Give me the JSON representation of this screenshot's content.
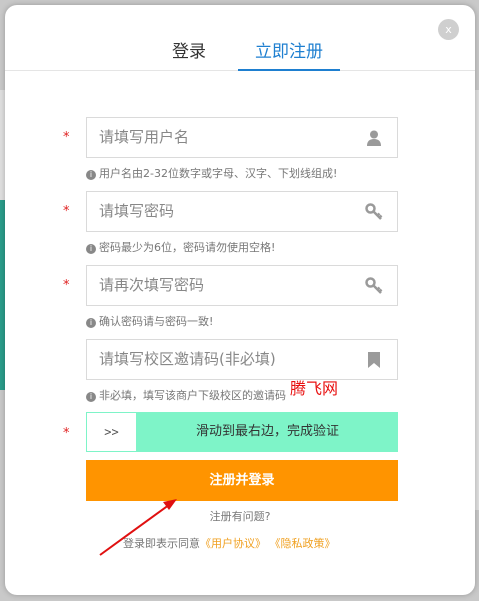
{
  "dialog": {
    "close_label": "x",
    "tabs": [
      {
        "label": "登录",
        "active": false
      },
      {
        "label": "立即注册",
        "active": true
      }
    ]
  },
  "form": {
    "username": {
      "placeholder": "请填写用户名",
      "hint": "用户名由2-32位数字或字母、汉字、下划线组成!",
      "required": "*",
      "icon": "user-icon"
    },
    "password": {
      "placeholder": "请填写密码",
      "hint": "密码最少为6位，密码请勿使用空格!",
      "required": "*",
      "icon": "key-icon"
    },
    "confirm": {
      "placeholder": "请再次填写密码",
      "hint": "确认密码请与密码一致!",
      "required": "*",
      "icon": "key-icon"
    },
    "invite": {
      "placeholder": "请填写校区邀请码(非必填)",
      "hint": "非必填，填写该商户下级校区的邀请码",
      "icon": "bookmark-icon"
    },
    "slider": {
      "required": "*",
      "handle": ">>",
      "text": "滑动到最右边，完成验证"
    },
    "submit_label": "注册并登录",
    "help_link": "注册有问题?",
    "agree_prefix": "登录即表示同意",
    "agree_user": "《用户协议》",
    "agree_privacy": "《隐私政策》"
  },
  "watermark": "腾飞网",
  "colors": {
    "accent": "#1e7fd0",
    "submit": "#ff9400",
    "slider": "#7ef4c8",
    "required": "#e02020"
  }
}
